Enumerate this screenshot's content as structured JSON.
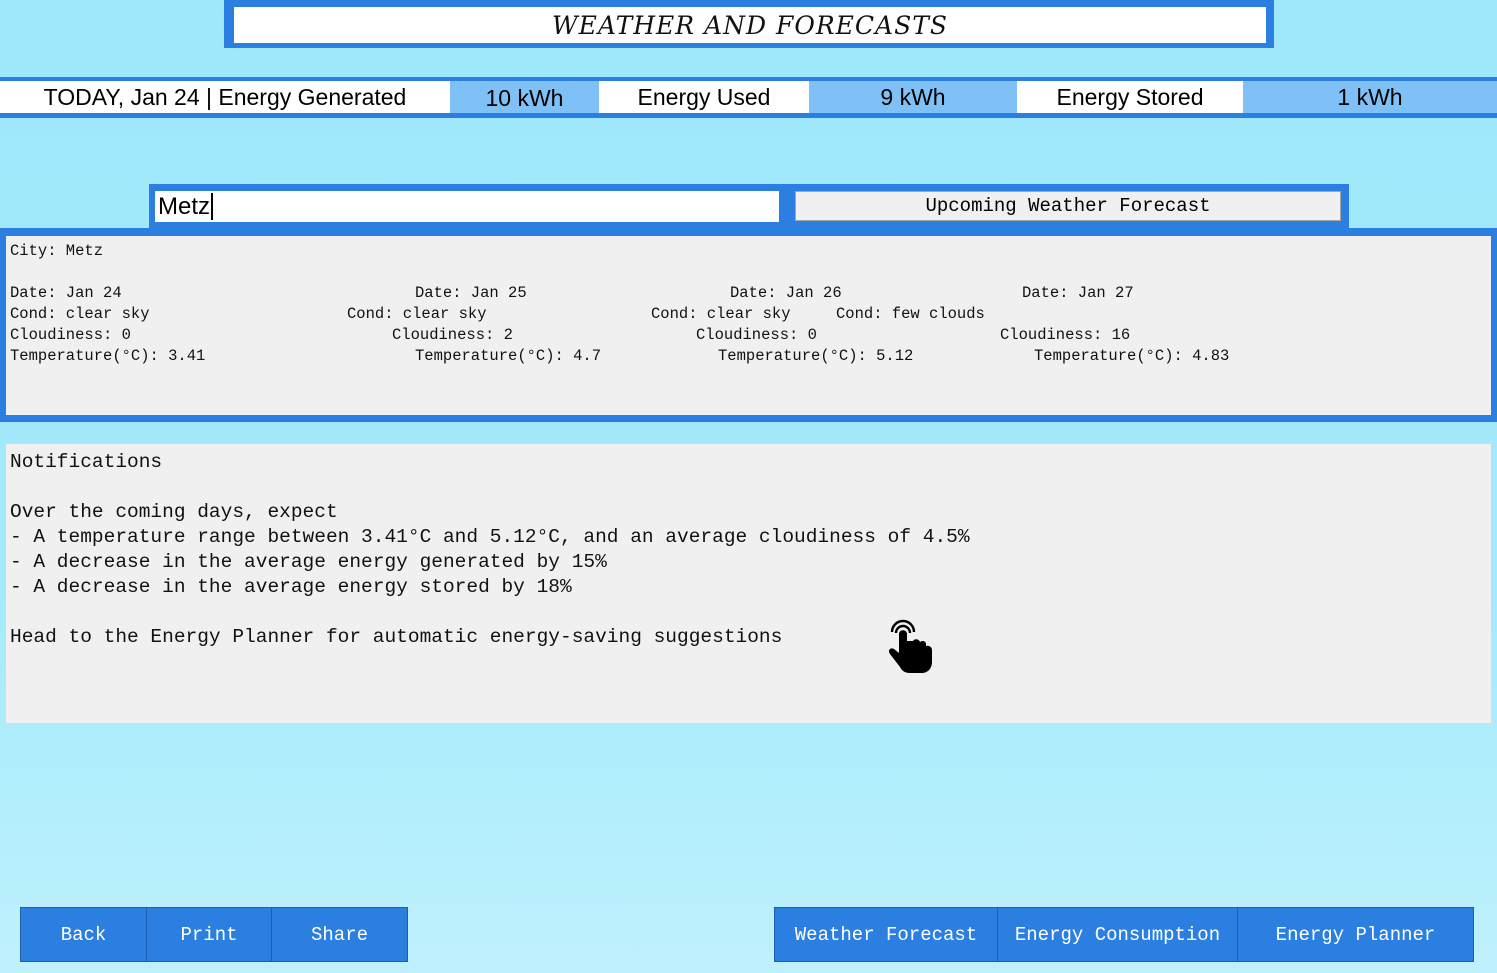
{
  "title": "WEATHER AND FORECASTS",
  "energy_bar": {
    "today_label": "TODAY, Jan 24 | Energy Generated",
    "generated_value": "10 kWh",
    "used_label": "Energy Used",
    "used_value": "9 kWh",
    "stored_label": "Energy Stored",
    "stored_value": "1 kWh"
  },
  "search": {
    "city_value": "Metz",
    "forecast_button": "Upcoming Weather Forecast"
  },
  "weather": {
    "city_line": "City: Metz",
    "days": [
      {
        "date": "Date: Jan 24",
        "cond": "Cond: clear sky",
        "cloudiness": "Cloudiness: 0",
        "temperature": "Temperature(°C): 3.41"
      },
      {
        "date": "Date: Jan 25",
        "cond": "Cond: clear sky",
        "cloudiness": "Cloudiness: 2",
        "temperature": "Temperature(°C): 4.7"
      },
      {
        "date": "Date: Jan 26",
        "cond": "Cond: clear sky",
        "cloudiness": "Cloudiness: 0",
        "temperature": "Temperature(°C): 5.12"
      },
      {
        "date": "Date: Jan 27",
        "cond": "Cond: few clouds",
        "cloudiness": "Cloudiness: 16",
        "temperature": "Temperature(°C): 4.83"
      }
    ]
  },
  "notifications": {
    "heading": "Notifications",
    "intro": "Over the coming days, expect",
    "items": [
      "- A temperature range between 3.41°C and 5.12°C, and an average cloudiness of 4.5%",
      "- A decrease in the average energy generated by 15%",
      "- A decrease in the average energy stored by 18%"
    ],
    "footer": "Head to the Energy Planner for automatic energy-saving suggestions"
  },
  "bottom_left_buttons": [
    "Back",
    "Print",
    "Share"
  ],
  "bottom_right_buttons": [
    "Weather Forecast",
    "Energy Consumption",
    "Energy Planner"
  ],
  "colors": {
    "background": "#a4eafb",
    "frame_blue": "#2a7fe0",
    "value_cell_blue": "#7fc1f6",
    "panel_gray": "#f0f0f0"
  },
  "icons": {
    "cursor": "pointing-hand-cursor-icon"
  }
}
